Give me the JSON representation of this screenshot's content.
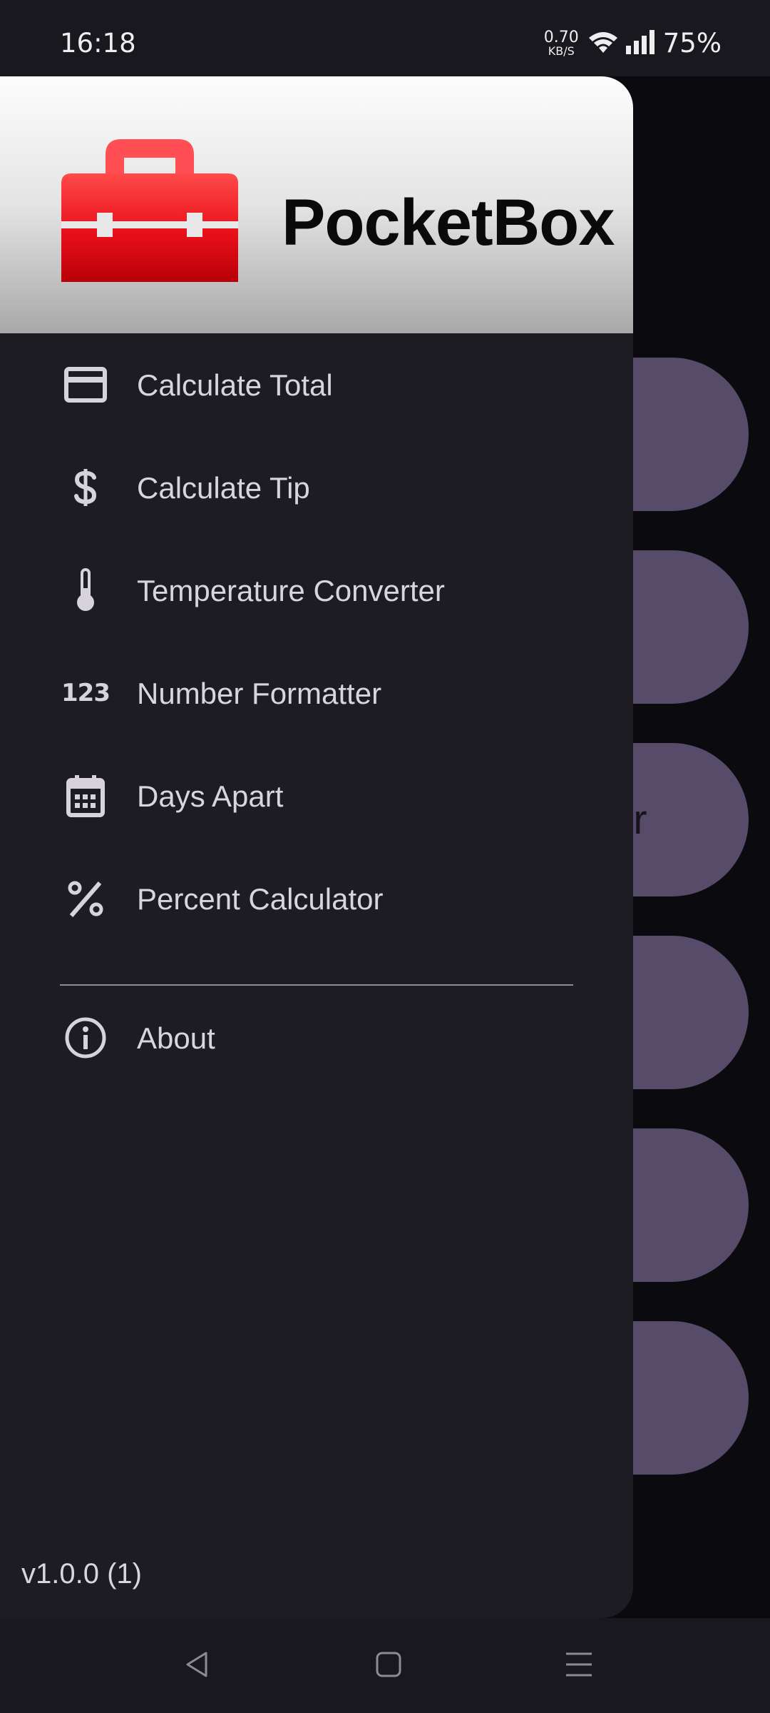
{
  "status_bar": {
    "time": "16:18",
    "net_speed_value": "0.70",
    "net_speed_unit": "KB/S",
    "battery": "75%",
    "icons": [
      "wifi-icon",
      "signal-icon"
    ]
  },
  "drawer": {
    "app_name": "PocketBox",
    "logo_icon": "toolbox-icon",
    "items": [
      {
        "label": "Calculate Total",
        "icon": "credit-card-icon"
      },
      {
        "label": "Calculate Tip",
        "icon": "dollar-icon"
      },
      {
        "label": "Temperature Converter",
        "icon": "thermometer-icon"
      },
      {
        "label": "Number Formatter",
        "icon": "numbers-123-icon",
        "icon_text": "123"
      },
      {
        "label": "Days Apart",
        "icon": "calendar-icon"
      },
      {
        "label": "Percent Calculator",
        "icon": "percent-icon"
      }
    ],
    "secondary_items": [
      {
        "label": "About",
        "icon": "info-icon"
      }
    ],
    "version": "v1.0.0 (1)"
  },
  "background": {
    "visible_partial_text": "er"
  },
  "nav_bar": {
    "buttons": [
      "back-icon",
      "home-icon",
      "recents-icon"
    ]
  },
  "colors": {
    "drawer_bg": "#1d1c22",
    "logo_red": "#e8101a",
    "bg_button": "#564c6a",
    "menu_text": "#d9d5df"
  }
}
